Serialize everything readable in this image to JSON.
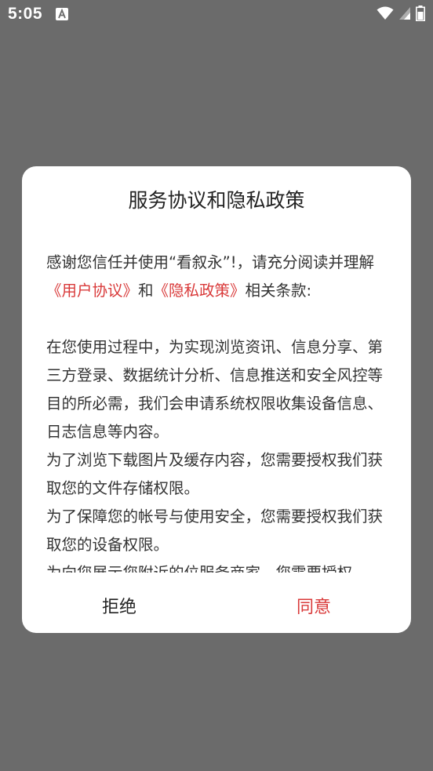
{
  "status_bar": {
    "time": "5:05",
    "notif_icon": "accessibility-a-icon",
    "wifi_icon": "wifi-icon",
    "signal_icon": "cell-signal-icon",
    "battery_icon": "battery-icon"
  },
  "dialog": {
    "title": "服务协议和隐私政策",
    "intro": {
      "prefix": "感谢您信任并使用“看叙永”!，请充分阅读并理解",
      "user_agreement": "《用户协议》",
      "and": "和",
      "privacy_policy": "《隐私政策》",
      "suffix": "相关条款:"
    },
    "paragraphs": [
      "在您使用过程中，为实现浏览资讯、信息分享、第三方登录、数据统计分析、信息推送和安全风控等目的所必需，我们会申请系统权限收集设备信息、日志信息等内容。",
      "为了浏览下载图片及缓存内容，您需要授权我们获取您的文件存储权限。",
      "为了保障您的帐号与使用安全，您需要授权我们获取您的设备权限。",
      "为向您展示您附近的位服务商家，您需要授权"
    ],
    "reject_label": "拒绝",
    "agree_label": "同意"
  },
  "colors": {
    "accent": "#d93a3a",
    "overlay": "#6b6b6b"
  }
}
